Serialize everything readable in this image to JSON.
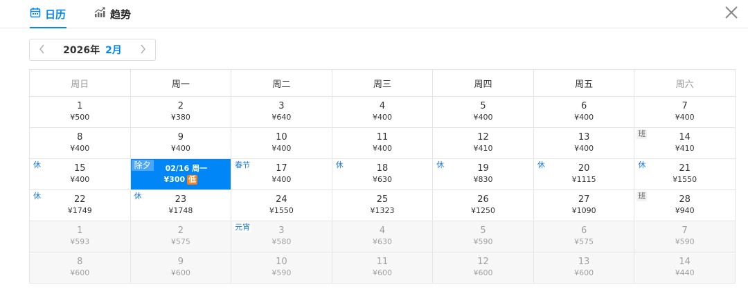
{
  "tabs": {
    "calendar_label": "日历",
    "trend_label": "趋势"
  },
  "month_nav": {
    "year": "2026年",
    "month": "2月"
  },
  "weekdays": [
    "周日",
    "周一",
    "周二",
    "周三",
    "周四",
    "周五",
    "周六"
  ],
  "weeks": [
    [
      {
        "day": "1",
        "price": "¥500"
      },
      {
        "day": "2",
        "price": "¥380"
      },
      {
        "day": "3",
        "price": "¥640"
      },
      {
        "day": "4",
        "price": "¥400"
      },
      {
        "day": "5",
        "price": "¥400"
      },
      {
        "day": "6",
        "price": "¥400"
      },
      {
        "day": "7",
        "price": "¥400"
      }
    ],
    [
      {
        "day": "8",
        "price": "¥400"
      },
      {
        "day": "9",
        "price": "¥400"
      },
      {
        "day": "10",
        "price": "¥400"
      },
      {
        "day": "11",
        "price": "¥400"
      },
      {
        "day": "12",
        "price": "¥410"
      },
      {
        "day": "13",
        "price": "¥400"
      },
      {
        "day": "14",
        "price": "¥410",
        "tag": "班"
      }
    ],
    [
      {
        "day": "15",
        "price": "¥400",
        "tag": "休"
      },
      {
        "selected": true,
        "tag": "除夕",
        "date_text": "02/16 周一",
        "price": "¥300",
        "low_label": "低"
      },
      {
        "day": "17",
        "price": "¥400",
        "tag": "春节"
      },
      {
        "day": "18",
        "price": "¥630",
        "tag": "休"
      },
      {
        "day": "19",
        "price": "¥830",
        "tag": "休"
      },
      {
        "day": "20",
        "price": "¥1115",
        "tag": "休"
      },
      {
        "day": "21",
        "price": "¥1550",
        "tag": "休"
      }
    ],
    [
      {
        "day": "22",
        "price": "¥1749",
        "tag": "休"
      },
      {
        "day": "23",
        "price": "¥1748",
        "tag": "休"
      },
      {
        "day": "24",
        "price": "¥1550"
      },
      {
        "day": "25",
        "price": "¥1323"
      },
      {
        "day": "26",
        "price": "¥1250"
      },
      {
        "day": "27",
        "price": "¥1090"
      },
      {
        "day": "28",
        "price": "¥940",
        "tag": "班"
      }
    ],
    [
      {
        "day": "1",
        "price": "¥593",
        "next": true
      },
      {
        "day": "2",
        "price": "¥575",
        "next": true
      },
      {
        "day": "3",
        "price": "¥580",
        "next": true,
        "tag": "元宵"
      },
      {
        "day": "4",
        "price": "¥630",
        "next": true
      },
      {
        "day": "5",
        "price": "¥590",
        "next": true
      },
      {
        "day": "6",
        "price": "¥575",
        "next": true
      },
      {
        "day": "7",
        "price": "¥590",
        "next": true
      }
    ],
    [
      {
        "day": "8",
        "price": "¥600",
        "next": true
      },
      {
        "day": "9",
        "price": "¥600",
        "next": true
      },
      {
        "day": "10",
        "price": "¥590",
        "next": true
      },
      {
        "day": "11",
        "price": "¥600",
        "next": true
      },
      {
        "day": "12",
        "price": "¥600",
        "next": true
      },
      {
        "day": "13",
        "price": "¥600",
        "next": true
      },
      {
        "day": "14",
        "price": "¥440",
        "next": true
      }
    ]
  ],
  "colors": {
    "accent": "#0086f6",
    "low_badge": "#ff7d13",
    "holiday_tag": "#1a7ad9"
  },
  "icons": {
    "calendar_tab": "calendar-icon",
    "trend_tab": "chart-trend-icon",
    "close": "close-icon",
    "prev": "chevron-left-icon",
    "next": "chevron-right-icon"
  }
}
